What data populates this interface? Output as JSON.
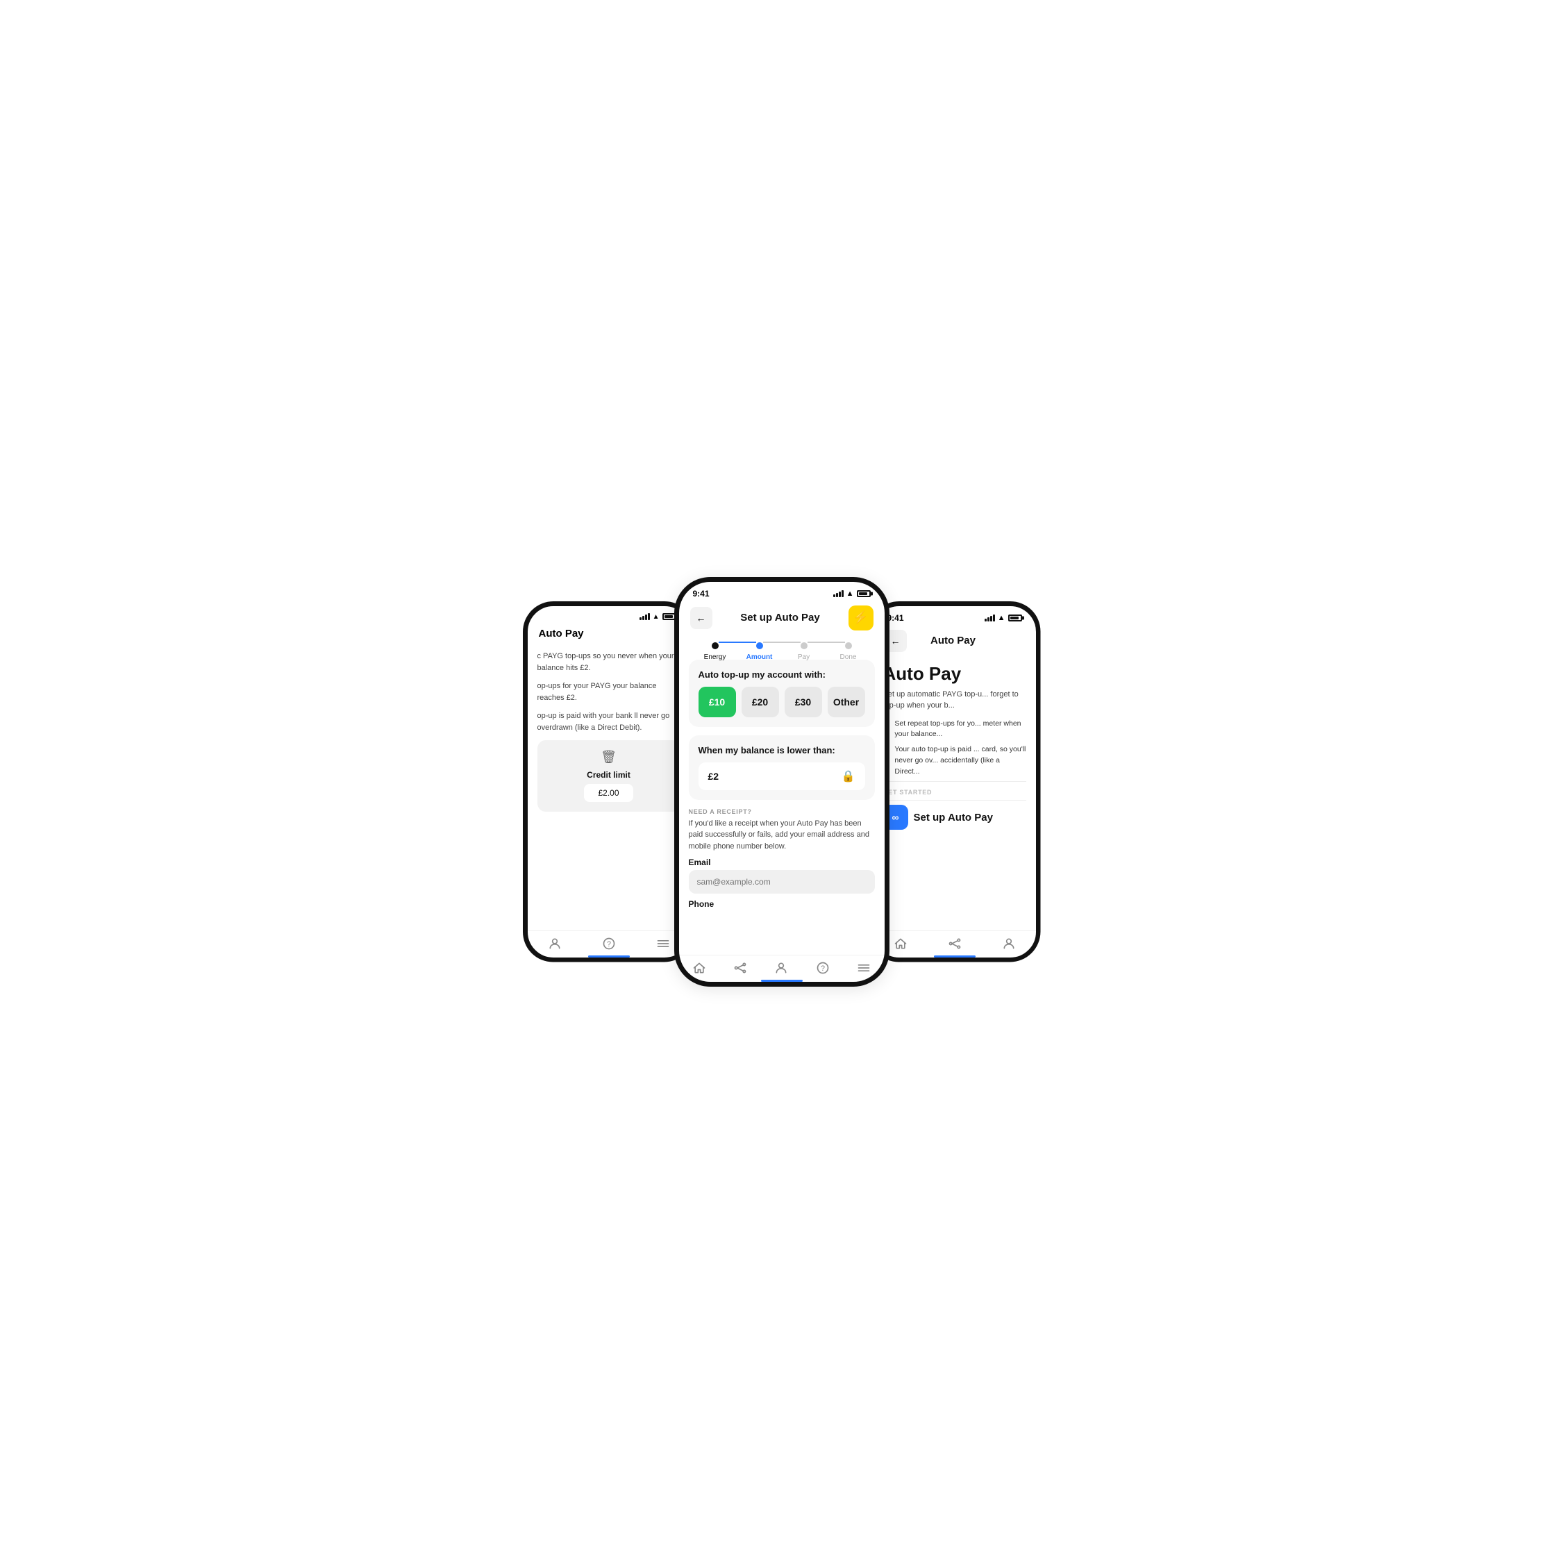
{
  "scene": {
    "phones": {
      "left": {
        "title": "Auto Pay",
        "status_time": "",
        "texts": [
          "c PAYG top-ups so you never when your balance hits £2.",
          "op-ups for your PAYG your balance reaches £2.",
          "op-up is paid with your bank ll never go overdrawn (like a Direct Debit)."
        ],
        "credit_limit_label": "Credit limit",
        "credit_limit_value": "£2.00",
        "nav_indicator": true
      },
      "center": {
        "status_time": "9:41",
        "header_title": "Set up Auto Pay",
        "back_label": "←",
        "steps": [
          {
            "label": "Energy",
            "state": "done"
          },
          {
            "label": "Amount",
            "state": "active"
          },
          {
            "label": "Pay",
            "state": "default"
          },
          {
            "label": "Done",
            "state": "default"
          }
        ],
        "auto_topup_title": "Auto top-up my account with:",
        "amount_options": [
          {
            "value": "£10",
            "selected": true
          },
          {
            "value": "£20",
            "selected": false
          },
          {
            "value": "£30",
            "selected": false
          },
          {
            "value": "Other",
            "selected": false
          }
        ],
        "balance_title": "When my balance is lower than:",
        "balance_value": "£2",
        "receipt_label": "NEED A RECEIPT?",
        "receipt_desc": "If you'd like a receipt when your Auto Pay has been paid successfully or fails, add your email address and mobile phone number below.",
        "email_label": "Email",
        "email_placeholder": "sam@example.com",
        "phone_label": "Phone",
        "nav_indicator": true
      },
      "right": {
        "status_time": "9:41",
        "back_label": "←",
        "header_title": "Auto Pay",
        "main_title": "Auto Pay",
        "main_desc": "Set up automatic PAYG top-u... forget to top-up when your b...",
        "check_items": [
          "Set repeat top-ups for yo... meter when your balance...",
          "Your auto top-up is paid ... card, so you'll never go ov... accidentally (like a Direct..."
        ],
        "get_started_label": "GET STARTED",
        "setup_btn_label": "Set up Auto Pay",
        "nav_indicator": true
      }
    }
  },
  "icons": {
    "back": "←",
    "lightning": "⚡",
    "lock": "🔒",
    "trash": "🗑",
    "infinity": "∞",
    "checkmark": "✓",
    "home": "⌂",
    "nodes": "⊙",
    "account": "£",
    "help": "?",
    "menu": "≡"
  },
  "colors": {
    "accent_blue": "#2979FF",
    "accent_green": "#22C55E",
    "accent_yellow": "#FFD600",
    "bg_light": "#f7f7f7",
    "text_dark": "#111111",
    "text_muted": "#999999"
  }
}
